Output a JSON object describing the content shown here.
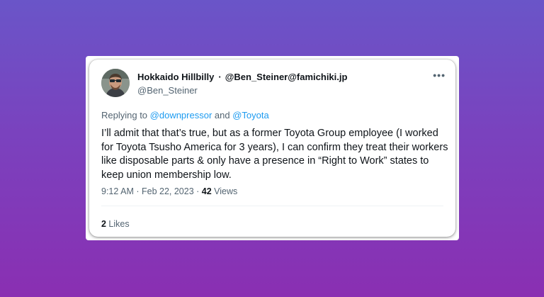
{
  "tweet": {
    "author": {
      "display_name": "Hokkaido Hillbilly",
      "separator": "·",
      "long_handle": "@Ben_Steiner@famichiki.jp",
      "handle": "@Ben_Steiner",
      "avatar_icon": "profile-photo-icon"
    },
    "more_label": "•••",
    "replying": {
      "prefix": "Replying to ",
      "mention_1": "@downpressor",
      "conjunction": " and ",
      "mention_2": "@Toyota"
    },
    "text": "I’ll admit that that’s true, but as a former Toyota Group employee (I worked for Toyota Tsusho America for 3 years), I can confirm they treat their workers like disposable parts & only have a presence in “Right to Work” states to keep union membership low.",
    "meta": {
      "time": "9:12 AM",
      "dot": " · ",
      "date": "Feb 22, 2023",
      "views_count": "42",
      "views_label": " Views"
    },
    "likes": {
      "count": "2",
      "label": " Likes"
    }
  },
  "colors": {
    "background_top": "#6a55c8",
    "background_bottom": "#8a2fb2",
    "link": "#1d9bf0",
    "secondary_text": "#536471"
  }
}
